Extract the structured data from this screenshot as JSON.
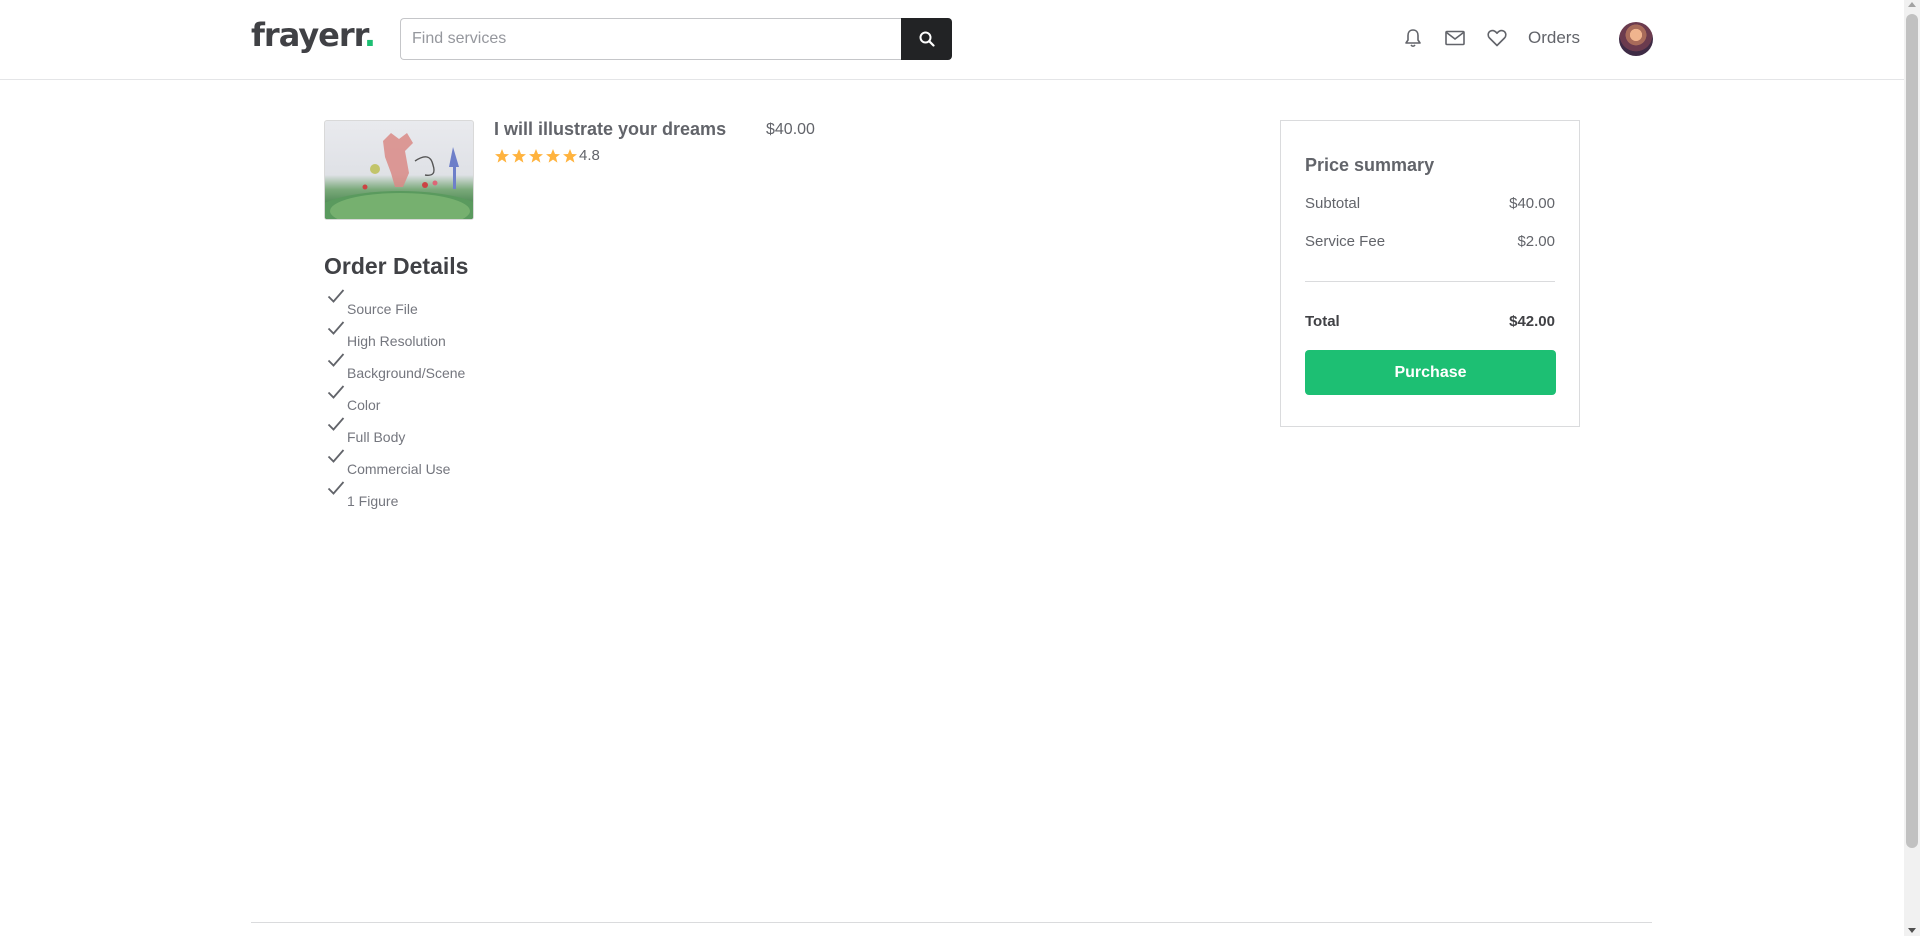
{
  "header": {
    "logo_text": "frayerr",
    "logo_dot": ".",
    "search_placeholder": "Find services",
    "search_value": "",
    "orders_label": "Orders",
    "icons": [
      "search-icon",
      "bell-icon",
      "mail-icon",
      "heart-icon",
      "avatar"
    ]
  },
  "gig": {
    "title": "I will illustrate your dreams",
    "price": "$40.00",
    "rating": "4.8",
    "stars": 5
  },
  "order_details": {
    "title": "Order Details",
    "features": [
      "Source File",
      "High Resolution",
      "Background/Scene",
      "Color",
      "Full Body",
      "Commercial Use",
      "1 Figure"
    ]
  },
  "summary": {
    "title": "Price summary",
    "subtotal_label": "Subtotal",
    "subtotal_value": "$40.00",
    "fee_label": "Service Fee",
    "fee_value": "$2.00",
    "total_label": "Total",
    "total_value": "$42.00",
    "purchase_label": "Purchase"
  },
  "colors": {
    "accent": "#1dbf73",
    "star": "#ffb33e",
    "text_dark": "#404145",
    "text_muted": "#62646a"
  }
}
